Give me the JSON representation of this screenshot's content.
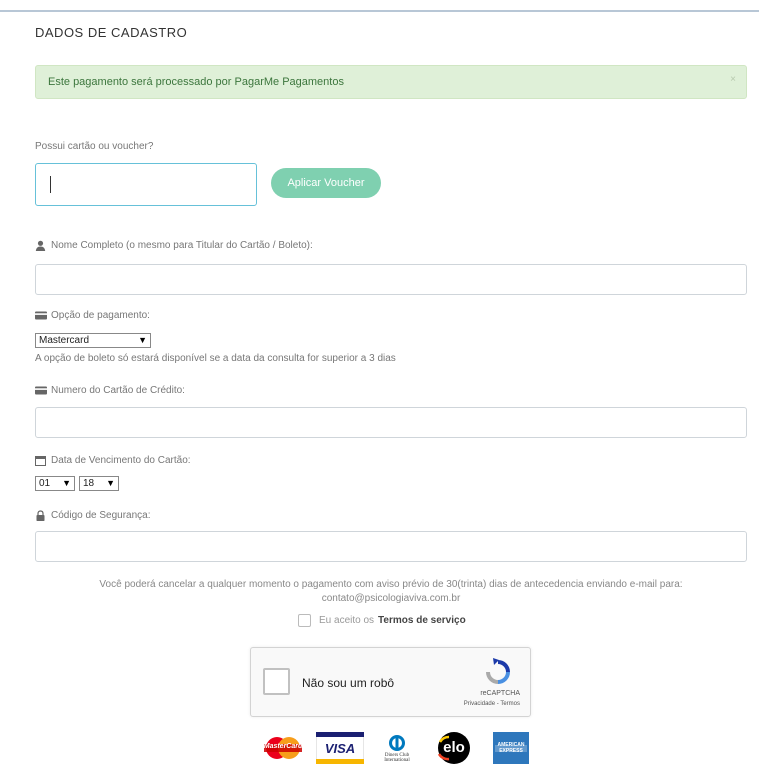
{
  "header": {
    "title": "DADOS DE CADASTRO"
  },
  "alert": {
    "message": "Este pagamento será processado por PagarMe Pagamentos",
    "close": "×"
  },
  "voucher": {
    "label": "Possui cartão ou voucher?",
    "value": "",
    "button": "Aplicar Voucher"
  },
  "name_field": {
    "label": "Nome Completo (o mesmo para Titular do Cartão / Boleto):",
    "value": ""
  },
  "payment": {
    "label": "Opção de pagamento:",
    "selected": "Mastercard",
    "hint": "A opção de boleto só estará disponível se a data da consulta for superior a 3 dias"
  },
  "card_number": {
    "label": "Numero do Cartão de Crédito:",
    "value": ""
  },
  "expiry": {
    "label": "Data de Vencimento do Cartão:",
    "month": "01",
    "year": "18"
  },
  "cvv": {
    "label": "Código de Segurança:",
    "value": ""
  },
  "notice": {
    "line1": "Você poderá cancelar a qualquer momento o pagamento com aviso prévio de 30(trinta) dias de antecedencia enviando e-mail para:",
    "line2": "contato@psicologiaviva.com.br"
  },
  "terms": {
    "prefix": "Eu aceito os",
    "link": "Termos de serviço"
  },
  "recaptcha": {
    "label": "Não sou um robô",
    "brand": "reCAPTCHA",
    "links": "Privacidade - Termos"
  },
  "cards": [
    {
      "name": "MasterCard",
      "icon": "mastercard-logo"
    },
    {
      "name": "VISA",
      "icon": "visa-logo"
    },
    {
      "name": "Diners Club International",
      "icon": "diners-logo"
    },
    {
      "name": "elo",
      "icon": "elo-logo"
    },
    {
      "name": "AMERICAN EXPRESS",
      "icon": "amex-logo"
    }
  ],
  "colors": {
    "accent": "#66c1d9",
    "voucher_button": "#7fd0b0",
    "alert_bg": "#dff0d8",
    "alert_text": "#3c763d"
  }
}
